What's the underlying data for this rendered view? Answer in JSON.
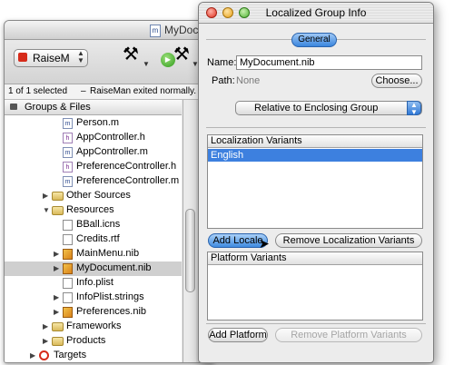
{
  "back_window": {
    "title": "MyDocum",
    "target_label": "RaiseM",
    "status_left": "1 of 1 selected",
    "status_right": "RaiseMan exited normally.",
    "groups_header": "Groups & Files",
    "tree": [
      {
        "label": "Person.m",
        "icon": "m-file-icon"
      },
      {
        "label": "AppController.h",
        "icon": "h-file-icon"
      },
      {
        "label": "AppController.m",
        "icon": "m-file-icon"
      },
      {
        "label": "PreferenceController.h",
        "icon": "h-file-icon"
      },
      {
        "label": "PreferenceController.m",
        "icon": "m-file-icon"
      },
      {
        "label": "Other Sources",
        "icon": "folder-icon"
      },
      {
        "label": "Resources",
        "icon": "folder-icon"
      },
      {
        "label": "BBall.icns",
        "icon": "file-icon"
      },
      {
        "label": "Credits.rtf",
        "icon": "file-icon"
      },
      {
        "label": "MainMenu.nib",
        "icon": "nib-icon"
      },
      {
        "label": "MyDocument.nib",
        "icon": "nib-icon"
      },
      {
        "label": "Info.plist",
        "icon": "file-icon"
      },
      {
        "label": "InfoPlist.strings",
        "icon": "file-icon"
      },
      {
        "label": "Preferences.nib",
        "icon": "nib-icon"
      },
      {
        "label": "Frameworks",
        "icon": "folder-icon"
      },
      {
        "label": "Products",
        "icon": "folder-icon"
      },
      {
        "label": "Targets",
        "icon": "target-icon"
      }
    ]
  },
  "info_window": {
    "title": "Localized Group Info",
    "tab_general": "General",
    "name_label": "Name:",
    "name_value": "MyDocument.nib",
    "path_label": "Path:",
    "path_value": "None",
    "choose_button": "Choose...",
    "relative_popup": "Relative to Enclosing Group",
    "localization_header": "Localization Variants",
    "localization_selected": "English",
    "add_locale_button": "Add Locale",
    "remove_localization_button": "Remove Localization Variants",
    "platform_header": "Platform Variants",
    "add_platform_button": "Add Platform",
    "remove_platform_button": "Remove Platform Variants"
  },
  "colors": {
    "selection_blue": "#3d80df",
    "aqua_blue": "#3a86de"
  }
}
